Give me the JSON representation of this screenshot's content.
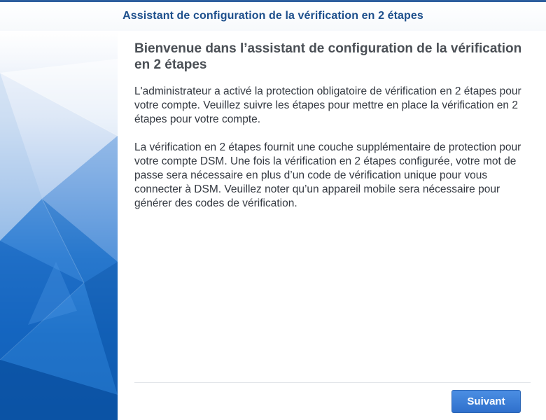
{
  "window": {
    "title": "Assistant de configuration de la vérification en 2 étapes"
  },
  "content": {
    "heading": "Bienvenue dans l’assistant de configuration de la vérification en 2 étapes",
    "paragraph_1": "L'administrateur a activé la protection obligatoire de vérification en 2 étapes pour votre compte. Veuillez suivre les étapes pour mettre en place la vérification en 2 étapes pour votre compte.",
    "paragraph_2": "La vérification en 2 étapes fournit une couche supplémentaire de protection pour votre compte DSM. Une fois la vérification en 2 étapes configurée, votre mot de passe sera nécessaire en plus d’un code de vérification unique pour vous connecter à DSM. Veuillez noter qu’un appareil mobile sera nécessaire pour générer des codes de vérification."
  },
  "footer": {
    "next_label": "Suivant"
  },
  "colors": {
    "title_text": "#1d4f8c",
    "accent_blue": "#2f70cc",
    "sidebar_blue": "#1f6bc0"
  }
}
